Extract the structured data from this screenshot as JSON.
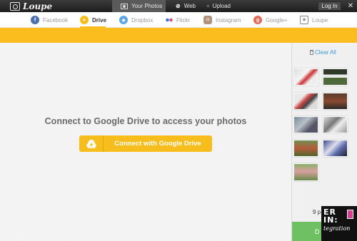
{
  "app": {
    "name": "Loupe"
  },
  "topnav": {
    "tabs": [
      {
        "label": "Your Photos",
        "icon": "photos-icon"
      },
      {
        "label": "Web",
        "icon": "globe-icon"
      },
      {
        "label": "Upload",
        "icon": "upload-icon"
      }
    ],
    "login_label": "Log In",
    "close_label": "✕"
  },
  "sources": [
    {
      "label": "Facebook",
      "icon": "facebook-icon",
      "color": "#4a6fb0",
      "glyph": "f"
    },
    {
      "label": "Drive",
      "icon": "drive-icon",
      "color": "#f6bd1c",
      "glyph": "▲"
    },
    {
      "label": "Dropbox",
      "icon": "dropbox-icon",
      "color": "#5aa8e4",
      "glyph": "◆"
    },
    {
      "label": "Flickr",
      "icon": "flickr-icon",
      "color": "#e6458c",
      "glyph": "●"
    },
    {
      "label": "Instagram",
      "icon": "instagram-icon",
      "color": "#b0917a",
      "glyph": "◘"
    },
    {
      "label": "Google+",
      "icon": "googleplus-icon",
      "color": "#e06a57",
      "glyph": "g"
    },
    {
      "label": "Loupe",
      "icon": "loupe-icon",
      "color": "#888888",
      "glyph": "◙"
    }
  ],
  "active_source": "Drive",
  "main": {
    "connect_text": "Connect to Google Drive to access your photos",
    "button_label": "Connect with Google Drive"
  },
  "sidebar": {
    "clear_label": "Clear All",
    "count_text": "9 p",
    "green_button_label": "D",
    "thumbnail_count": 9
  },
  "watermark": {
    "line1": "ER",
    "line2": "IN:",
    "line3": "tegration"
  },
  "colors": {
    "accent": "#fbbd1d",
    "link": "#3a9ad9",
    "green": "#6ec063"
  }
}
